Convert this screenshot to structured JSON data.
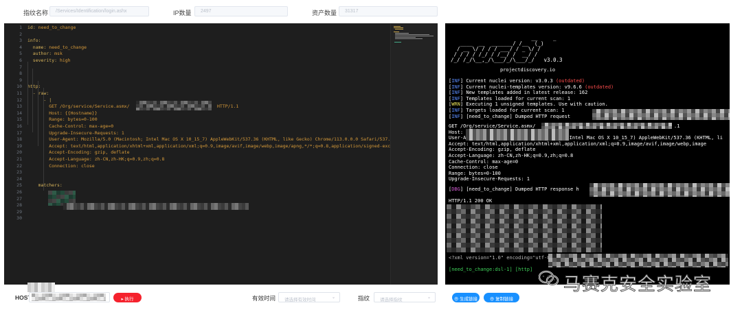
{
  "filters": {
    "fingerprint_label": "指纹名称",
    "fingerprint_value": "/Services/Identification/login.ashx",
    "ip_label": "IP数量",
    "ip_value": "2497",
    "asset_label": "资产数量",
    "asset_value": "31317"
  },
  "editor": {
    "line_numbers": [
      "1",
      "2",
      "3",
      "4",
      "5",
      "6",
      "7",
      "8",
      "9",
      "10",
      "11",
      "12",
      "13",
      "14",
      "15",
      "16",
      "17",
      "18",
      "19",
      "20",
      "21",
      "22",
      "23",
      "24",
      "25",
      "26",
      "27",
      "28",
      "29",
      "30"
    ],
    "lines": [
      {
        "n": 1,
        "indent": 0,
        "key": "id:",
        "val": " need_to_change"
      },
      {
        "n": 3,
        "indent": 0,
        "key": "info:",
        "val": ""
      },
      {
        "n": 4,
        "indent": 1,
        "key": "name:",
        "val": " need_to_change"
      },
      {
        "n": 5,
        "indent": 1,
        "key": "author:",
        "val": " msk"
      },
      {
        "n": 6,
        "indent": 1,
        "key": "severity:",
        "val": " high"
      },
      {
        "n": 10,
        "indent": 0,
        "key": "http:",
        "val": ""
      },
      {
        "n": 11,
        "indent": 1,
        "key": "- raw:",
        "val": ""
      },
      {
        "n": 12,
        "indent": 3,
        "key": "- |",
        "val": ""
      },
      {
        "n": 13,
        "indent": 4,
        "key": "",
        "val": "GET /Org/service/Service.asmx/"
      },
      {
        "n": 14,
        "indent": 4,
        "key": "",
        "val": "Host: {{Hostname}}"
      },
      {
        "n": 15,
        "indent": 4,
        "key": "",
        "val": "Range: bytes=0-100"
      },
      {
        "n": 16,
        "indent": 4,
        "key": "",
        "val": "Cache-Control: max-age=0"
      },
      {
        "n": 17,
        "indent": 4,
        "key": "",
        "val": "Upgrade-Insecure-Requests: 1"
      },
      {
        "n": 18,
        "indent": 4,
        "key": "",
        "val": "User-Agent: Mozilla/5.0 (Macintosh; Intel Mac OS X 10_15_7) AppleWebKit/537.36 (KHTML, like Gecko) Chrome/113.0.0.0 Safari/537.36"
      },
      {
        "n": 19,
        "indent": 4,
        "key": "",
        "val": "Accept: text/html,application/xhtml+xml,application/xml;q=0.9,image/avif,image/webp,image/apng,*/*;q=0.8,application/signed-exchange"
      },
      {
        "n": 20,
        "indent": 4,
        "key": "",
        "val": "Accept-Encoding: gzip, deflate"
      },
      {
        "n": 21,
        "indent": 4,
        "key": "",
        "val": "Accept-Language: zh-CN,zh-HK;q=0.9,zh;q=0.8"
      },
      {
        "n": 22,
        "indent": 4,
        "key": "",
        "val": "Connection: close"
      },
      {
        "n": 25,
        "indent": 2,
        "key": "matchers:",
        "val": ""
      }
    ],
    "line13_suffix": "HTTP/1.1"
  },
  "terminal": {
    "logo": [
      "                          __     _",
      "   ____  __  _______/ /__  (_)",
      "  / __ \\/ / / / ___/ / _ \\/ /",
      " / / / / /_/ / /__/ /  __/ /",
      "/_/ /_/\\__,_/\\___/_/\\___/_/   v3.0.3"
    ],
    "site": "projectdiscovery.io",
    "log": [
      {
        "tag": "INF",
        "cls": "tag-inf",
        "text": "Current nuclei version: v3.0.3 ",
        "extra": "(outdated)"
      },
      {
        "tag": "INF",
        "cls": "tag-inf",
        "text": "Current nuclei-templates version: v9.6.6 ",
        "extra": "(outdated)"
      },
      {
        "tag": "INF",
        "cls": "tag-inf",
        "text": "New templates added in latest release: 162",
        "extra": ""
      },
      {
        "tag": "INF",
        "cls": "tag-inf",
        "text": "Templates loaded for current scan: 1",
        "extra": ""
      },
      {
        "tag": "WRN",
        "cls": "tag-wrn",
        "text": "Executing 1 unsigned templates. Use with caution.",
        "extra": ""
      },
      {
        "tag": "INF",
        "cls": "tag-inf",
        "text": "Targets loaded for current scan: 1",
        "extra": ""
      },
      {
        "tag": "INF",
        "cls": "tag-inf",
        "text": "[need_to_change] Dumped HTTP request",
        "extra": ""
      }
    ],
    "request": [
      "GET /Org/service/Service.asmx/",
      "Host:",
      "User-A",
      "Accept: text/html,application/xhtml+xml,application/xml;q=0.9,image/avif,image/webp,image",
      "Accept-Encoding: gzip, deflate",
      "Accept-Language: zh-CN,zh-HK;q=0.9,zh;q=0.8",
      "Cache-Control: max-age=0",
      "Connection: close",
      "Range: bytes=0-100",
      "Upgrade-Insecure-Requests: 1"
    ],
    "request_line1_end": ".1",
    "request_ua_mid": "h; Intel Mac OS X 10_15_7) AppleWebKit/537.36 (KHTML, li",
    "dbg_tag": "DBG",
    "dbg_text": "[need_to_change] Dumped HTTP response h",
    "status": "HTTP/1.1 200 OK",
    "xml_line": "<?xml version=\"1.0\" encoding=\"utf-8\"",
    "match_line": "[need_to_change:dsl-1] [http]"
  },
  "bottom": {
    "host_label": "HOST",
    "run_button": "执行",
    "valid_label": "有效时间",
    "valid_placeholder": "请选择有效时间",
    "fp_label": "指纹",
    "fp_placeholder": "请选择指纹",
    "gen_button": "生成链接",
    "copy_button": "复制链接"
  },
  "watermark": "马赛克安全实验室",
  "colors": {
    "accent": "#1890ff",
    "run_red": "#f5222d",
    "editor_bg": "#1e1e1e",
    "yaml_key": "#d8b45a",
    "yaml_value": "#d69a3a"
  }
}
